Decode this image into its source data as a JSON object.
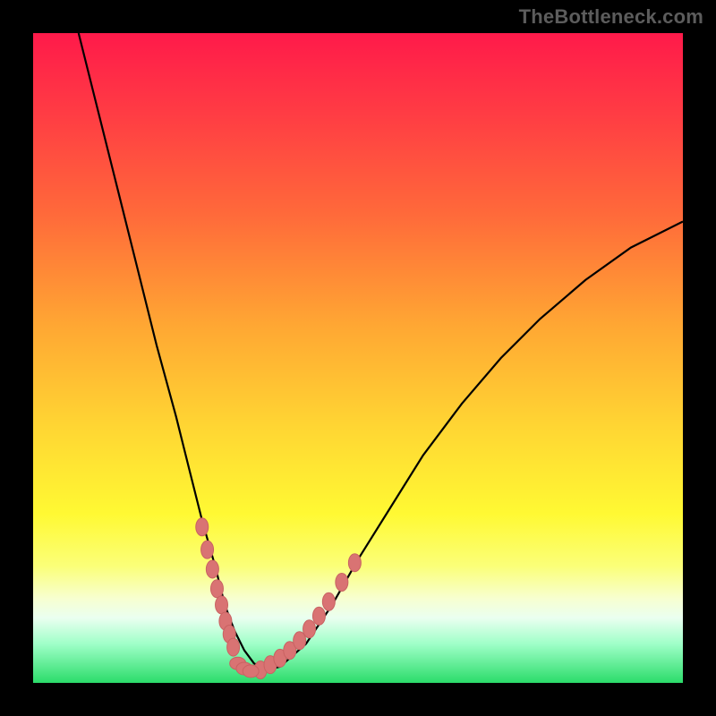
{
  "watermark": "TheBottleneck.com",
  "chart_data": {
    "type": "line",
    "title": "",
    "xlabel": "",
    "ylabel": "",
    "xlim": [
      0,
      100
    ],
    "ylim": [
      0,
      100
    ],
    "curve": {
      "x": [
        7,
        10,
        13,
        16,
        19,
        22,
        24,
        26,
        28,
        29.5,
        31,
        32.5,
        34,
        36,
        38,
        42,
        46,
        50,
        55,
        60,
        66,
        72,
        78,
        85,
        92,
        100
      ],
      "y": [
        100,
        88,
        76,
        64,
        52,
        41,
        33,
        25,
        18,
        12,
        8,
        5,
        3,
        2,
        2.5,
        6,
        12,
        19,
        27,
        35,
        43,
        50,
        56,
        62,
        67,
        71
      ]
    },
    "left_dots": {
      "x": [
        26.0,
        26.8,
        27.6,
        28.3,
        29.0,
        29.6,
        30.2,
        30.8
      ],
      "y": [
        24.0,
        20.5,
        17.5,
        14.5,
        12.0,
        9.5,
        7.5,
        5.5
      ]
    },
    "right_dots": {
      "x": [
        35.0,
        36.5,
        38.0,
        39.5,
        41.0,
        42.5,
        44.0,
        45.5,
        47.5,
        49.5
      ],
      "y": [
        2.0,
        2.8,
        3.8,
        5.0,
        6.5,
        8.3,
        10.3,
        12.5,
        15.5,
        18.5
      ]
    },
    "bottom_dots": {
      "x": [
        31.5,
        32.5,
        33.5
      ],
      "y": [
        3.0,
        2.2,
        1.8
      ]
    }
  }
}
